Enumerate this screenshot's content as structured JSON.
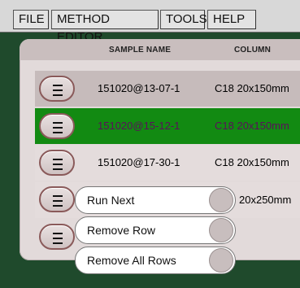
{
  "menubar": {
    "items": [
      "FILE",
      "METHOD EDITOR",
      "TOOLS",
      "HELP"
    ]
  },
  "table": {
    "headers": {
      "sample": "SAMPLE NAME",
      "column": "COLUMN"
    },
    "rows": [
      {
        "sample": "151020@13-07-1",
        "column": "C18 20x150mm"
      },
      {
        "sample": "151020@15-12-1",
        "column": "C18 20x150mm"
      },
      {
        "sample": "151020@17-30-1",
        "column": "C18 20x150mm"
      },
      {
        "sample": "",
        "column": "20x250mm"
      }
    ]
  },
  "context_menu": {
    "items": [
      "Run Next",
      "Remove Row",
      "Remove All Rows"
    ]
  },
  "colors": {
    "selected_row": "#128a12",
    "background": "#1f4a2c"
  },
  "icons": {
    "row_handle": "menu-icon"
  }
}
